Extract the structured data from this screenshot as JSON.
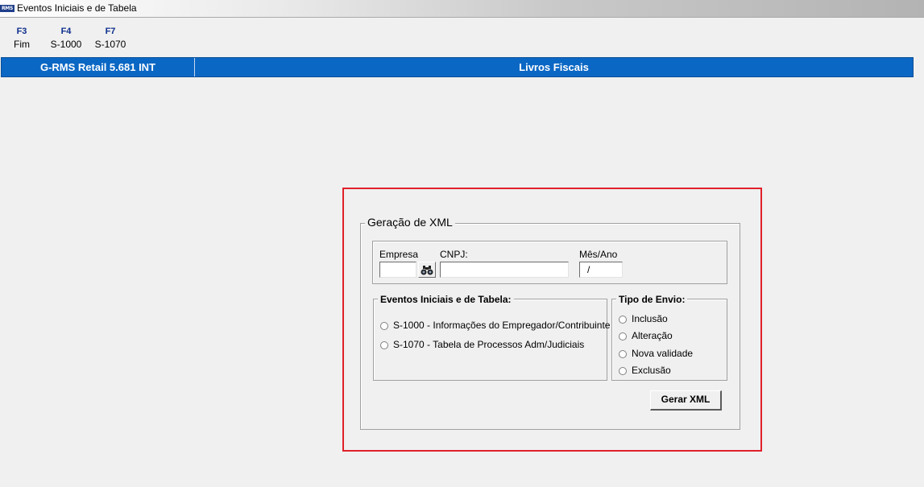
{
  "window": {
    "title": "Eventos Iniciais e de Tabela",
    "icon": "RMS"
  },
  "function_keys": [
    {
      "key": "F3",
      "action": "Fim"
    },
    {
      "key": "F4",
      "action": "S-1000"
    },
    {
      "key": "F7",
      "action": "S-1070"
    }
  ],
  "banner": {
    "app_version": "G-RMS Retail 5.681 INT",
    "module": "Livros Fiscais"
  },
  "form": {
    "title": "Geração de XML",
    "empresa_label": "Empresa",
    "empresa_value": "",
    "cnpj_label": "CNPJ:",
    "cnpj_value": "",
    "mes_ano_label": "Mês/Ano",
    "mes_ano_value": "/",
    "eventos": {
      "title": "Eventos Iniciais e de Tabela:",
      "options": [
        "S-1000 - Informações do Empregador/Contribuinte",
        "S-1070 - Tabela de Processos Adm/Judiciais"
      ]
    },
    "tipo_envio": {
      "title": "Tipo de Envio:",
      "options": [
        "Inclusão",
        "Alteração",
        "Nova validade",
        "Exclusão"
      ]
    },
    "gerar_button": "Gerar XML"
  },
  "colors": {
    "banner": "#0b67c4",
    "highlight": "#e0202a",
    "function_key": "#0c2d8c"
  }
}
